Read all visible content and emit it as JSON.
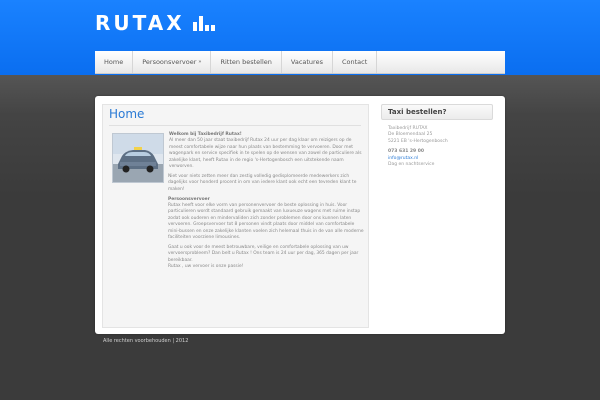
{
  "brand": {
    "name": "RUTAX",
    "logo_icon": "bar-chart-icon"
  },
  "nav": {
    "items": [
      {
        "label": "Home"
      },
      {
        "label": "Persoonsvervoer",
        "has_dropdown": true,
        "dropdown_marker": "»"
      },
      {
        "label": "Ritten bestellen"
      },
      {
        "label": "Vacatures"
      },
      {
        "label": "Contact"
      }
    ]
  },
  "main": {
    "title": "Home",
    "article": {
      "intro_heading": "Welkom bij Taxibedrijf Rutax!",
      "intro_text": "Al meer dan 50 jaar staat taxibedrijf Rutax 24 uur per dag klaar om reizigers op de meest comfortabele wijze naar hun plaats van bestemming te vervoeren. Door met wagenpark en service specifiek in te spelen op de wensen van zowel de particuliere als zakelijke klant, heeft Rutax in de regio 's-Hertogenbosch een uitstekende naam verworven.",
      "para2": "Niet voor niets zetten meer dan zestig volledig gedisplomeerde medewerkers zich dagelijks voor honderd procent in om van iedere klant ook echt een tevreden klant te maken!",
      "section_heading": "Persoonsvervoer",
      "section_text": "Rutax heeft voor elke vorm van personenvervoer de beste oplossing in huis. Voor particulieren wordt standaard gebruik gemaakt van luxueuze wagens met ruime instap zodat ook ouderen en mindervaliden zich zonder problemen door ons kunnen laten vervoeren. Groepsvervoer tot 8 personen vindt plaats door middel van comfortabele mini-bussen en onze zakelijke klanten voelen zich helemaal thuis in de van alle moderne faciliteiten voorziene limousines.",
      "para4": "Gaat u ook voor de meest betrouwbare, veilige en comfortabele oplossing van uw vervoersprobleem? Dan belt u Rutax ! Ons team is 24 uur per dag, 365 dagen per jaar bereikbaar.",
      "tagline": "Rutax , uw vervoer is onze passie!"
    }
  },
  "sidebar": {
    "title": "Taxi bestellen?",
    "company": "Taxibedrijf RUTAX",
    "street": "De Bloemendaal 25",
    "city": "5221 EB 's-Hertogenbosch",
    "phone": "073 631 29 00",
    "email": "info@rutax.nl",
    "hours": "Dag en nachtservice"
  },
  "footer": {
    "copyright": "Alle rechten voorbehouden | 2012"
  },
  "colors": {
    "header_blue": "#1a82ff",
    "accent_blue": "#2a7ad5",
    "background_dark": "#3a3a3a"
  }
}
